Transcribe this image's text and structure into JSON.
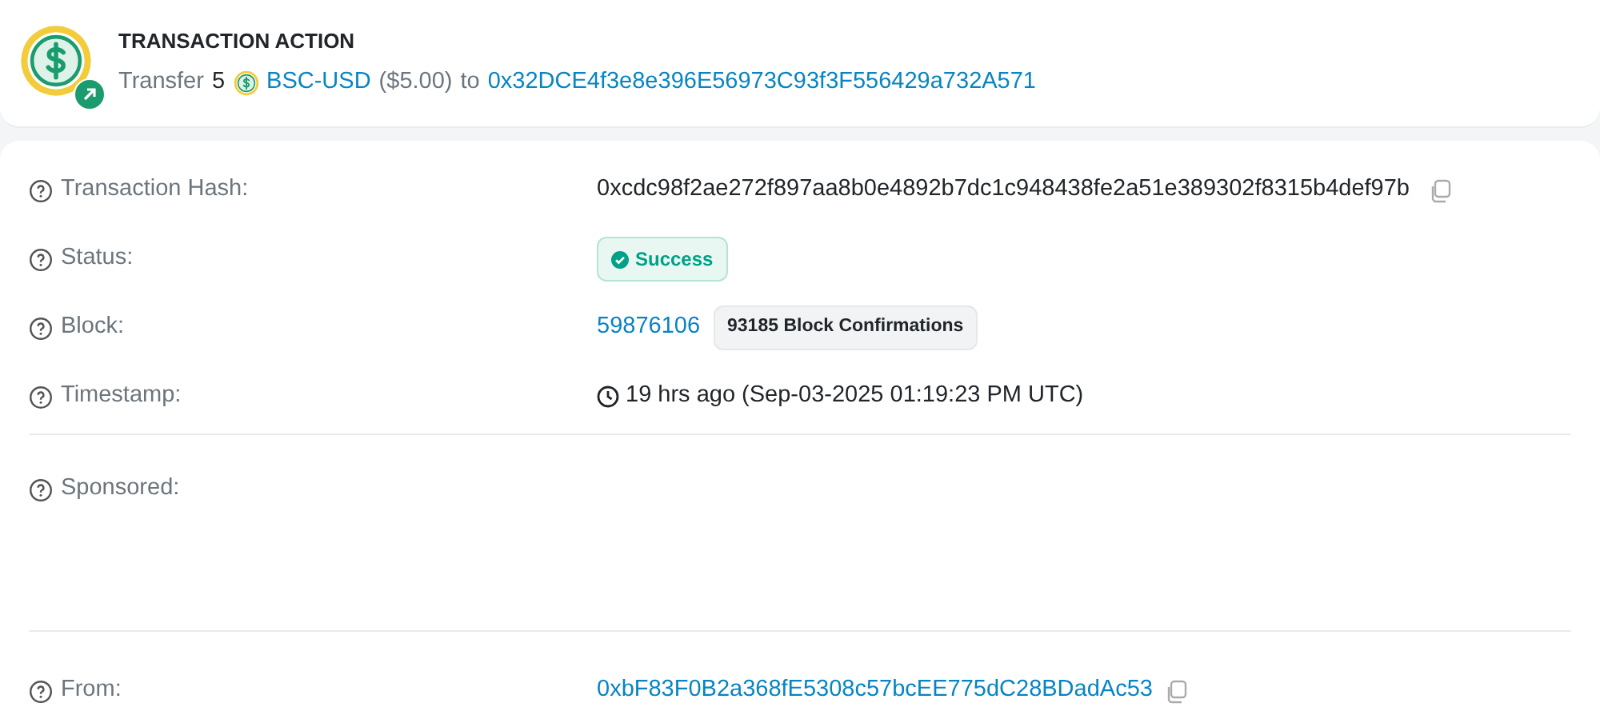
{
  "action": {
    "heading": "TRANSACTION ACTION",
    "verb": "Transfer",
    "amount": "5",
    "token": "BSC-USD",
    "usd": "($5.00)",
    "to_word": "to",
    "to_address": "0x32DCE4f3e8e396E56973C93f3F556429a732A571"
  },
  "sections": [
    {
      "rows": [
        {
          "kind": "hash",
          "label": "Transaction Hash:",
          "value": "0xcdc98f2ae272f897aa8b0e4892b7dc1c948438fe2a51e389302f8315b4def97b"
        },
        {
          "kind": "status",
          "label": "Status:",
          "value": "Success"
        },
        {
          "kind": "block",
          "label": "Block:",
          "value": "59876106",
          "badge": "93185 Block Confirmations"
        },
        {
          "kind": "time",
          "label": "Timestamp:",
          "value": "19 hrs ago (Sep-03-2025 01:19:23 PM UTC)"
        }
      ]
    },
    {
      "rows": [
        {
          "kind": "sponsored",
          "label": "Sponsored:"
        }
      ]
    },
    {
      "rows": [
        {
          "kind": "address",
          "label": "From:",
          "value": "0xbF83F0B2a368fE5308c57bcEE775dC28BDadAc53"
        }
      ]
    }
  ]
}
